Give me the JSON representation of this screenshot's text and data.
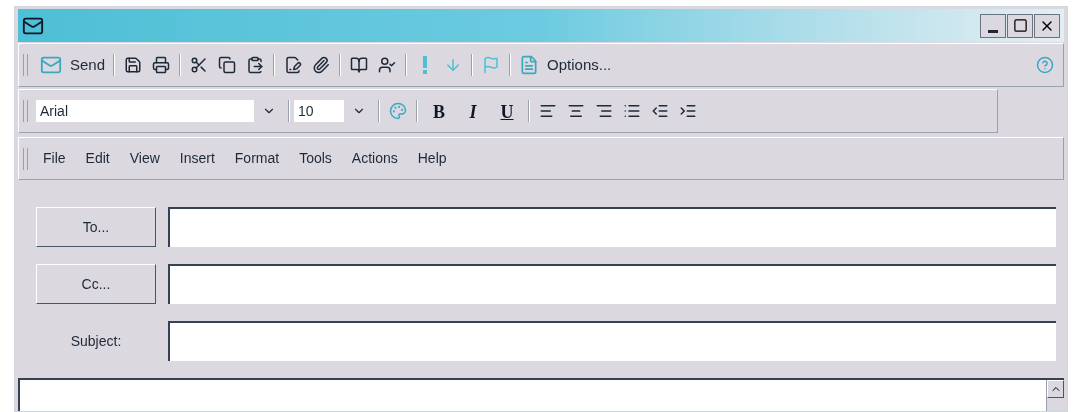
{
  "standard_toolbar": {
    "send_button": "Send",
    "options_button": "Options..."
  },
  "formatting_toolbar": {
    "font": "Arial",
    "size": "10",
    "bold": "B",
    "italic": "I",
    "underline": "U"
  },
  "menu_bar": [
    {
      "label": "File"
    },
    {
      "label": "Edit"
    },
    {
      "label": "View"
    },
    {
      "label": "Insert"
    },
    {
      "label": "Format"
    },
    {
      "label": "Tools"
    },
    {
      "label": "Actions"
    },
    {
      "label": "Help"
    }
  ],
  "header_fields": [
    {
      "label": "To...",
      "kind": "button"
    },
    {
      "label": "Cc...",
      "kind": "button"
    },
    {
      "label": "Subject:",
      "kind": "label"
    }
  ]
}
